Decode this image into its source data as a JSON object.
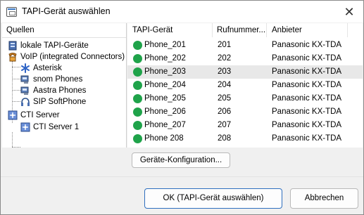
{
  "window": {
    "title": "TAPI-Gerät auswählen",
    "close_glyph": "✕"
  },
  "sources": {
    "header": "Quellen",
    "items": [
      {
        "label": "lokale TAPI-Geräte",
        "icon": "server-icon"
      },
      {
        "label": "VoIP (integrated Connectors)",
        "icon": "voip-phone-icon"
      },
      {
        "label": "Asterisk",
        "icon": "asterisk-icon"
      },
      {
        "label": "snom Phones",
        "icon": "desk-phone-icon"
      },
      {
        "label": "Aastra Phones",
        "icon": "desk-phone-icon"
      },
      {
        "label": "SIP SoftPhone",
        "icon": "headset-icon"
      },
      {
        "label": "CTI Server",
        "icon": "network-icon"
      },
      {
        "label": "CTI Server 1",
        "icon": "network-icon"
      }
    ]
  },
  "devices": {
    "columns": [
      "TAPI-Gerät",
      "Rufnummer...",
      "Anbieter"
    ],
    "rows": [
      {
        "name": "Phone_201",
        "number": "201",
        "provider": "Panasonic KX-TDA"
      },
      {
        "name": "Phone_202",
        "number": "202",
        "provider": "Panasonic KX-TDA"
      },
      {
        "name": "Phone_203",
        "number": "203",
        "provider": "Panasonic KX-TDA"
      },
      {
        "name": "Phone_204",
        "number": "204",
        "provider": "Panasonic KX-TDA"
      },
      {
        "name": "Phone_205",
        "number": "205",
        "provider": "Panasonic KX-TDA"
      },
      {
        "name": "Phone_206",
        "number": "206",
        "provider": "Panasonic KX-TDA"
      },
      {
        "name": "Phone_207",
        "number": "207",
        "provider": "Panasonic KX-TDA"
      },
      {
        "name": "Phone 208",
        "number": "208",
        "provider": "Panasonic KX-TDA"
      }
    ],
    "selected_row": 2,
    "status_color": "#1fa34a"
  },
  "buttons": {
    "config": "Geräte-Konfiguration...",
    "ok": "OK   (TAPI-Gerät auswählen)",
    "cancel": "Abbrechen"
  }
}
